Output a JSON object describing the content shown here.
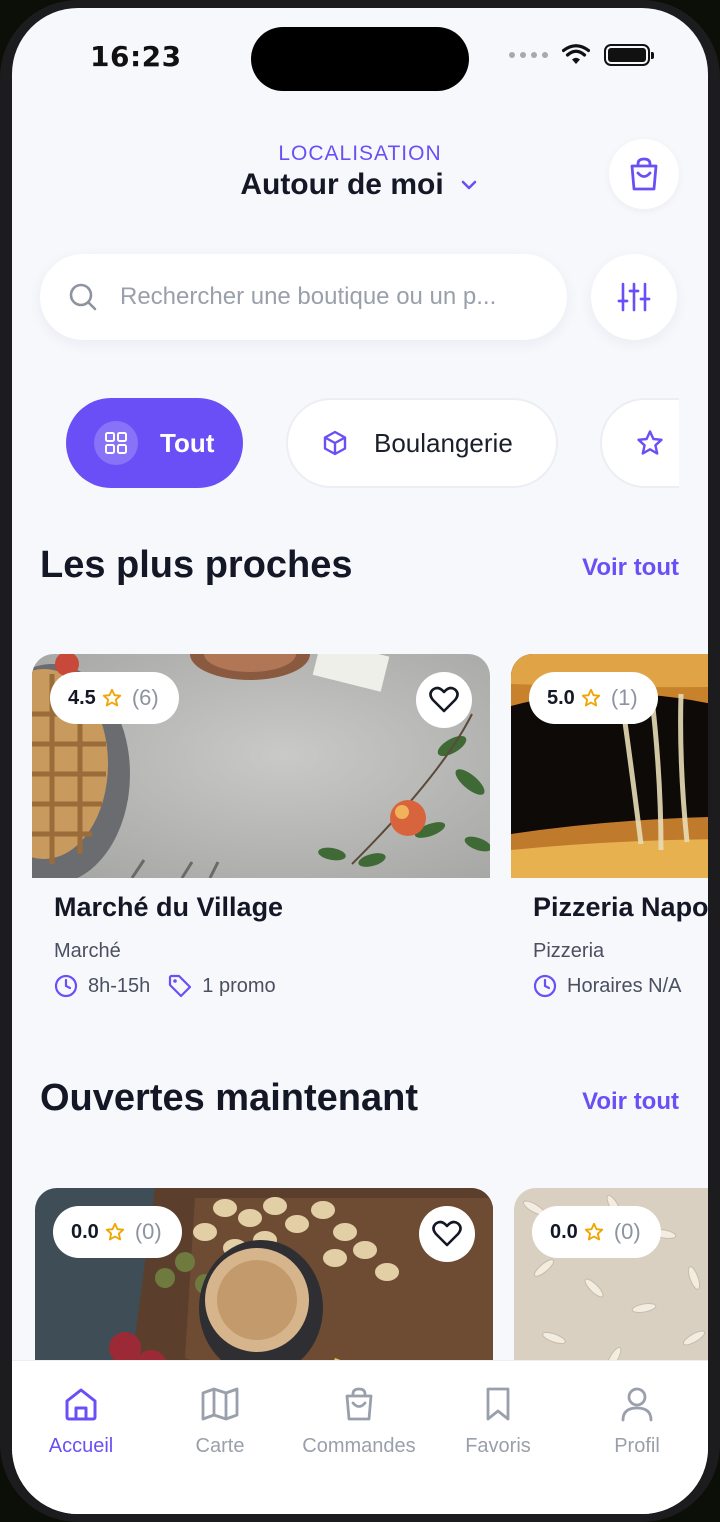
{
  "status": {
    "time": "16:23"
  },
  "location": {
    "label": "LOCALISATION",
    "value": "Autour de moi"
  },
  "search": {
    "placeholder": "Rechercher une boutique ou un p..."
  },
  "categories": [
    {
      "label": "Tout",
      "icon": "grid-icon",
      "active": true
    },
    {
      "label": "Boulangerie",
      "icon": "box-icon",
      "active": false
    },
    {
      "label": "",
      "icon": "star-icon",
      "active": false
    }
  ],
  "sections": [
    {
      "title": "Les plus proches",
      "see_all": "Voir tout",
      "cards": [
        {
          "rating": "4.5",
          "count": "(6)",
          "name": "Marché du Village",
          "category": "Marché",
          "hours": "8h-15h",
          "promo": "1 promo"
        },
        {
          "rating": "5.0",
          "count": "(1)",
          "name": "Pizzeria Napo",
          "category": "Pizzeria",
          "hours": "Horaires N/A"
        }
      ]
    },
    {
      "title": "Ouvertes maintenant",
      "see_all": "Voir tout",
      "cards": [
        {
          "rating": "0.0",
          "count": "(0)"
        },
        {
          "rating": "0.0",
          "count": "(0)"
        }
      ]
    }
  ],
  "tabbar": [
    {
      "label": "Accueil",
      "icon": "home-icon",
      "active": true
    },
    {
      "label": "Carte",
      "icon": "map-icon",
      "active": false
    },
    {
      "label": "Commandes",
      "icon": "bag-icon",
      "active": false
    },
    {
      "label": "Favoris",
      "icon": "bookmark-icon",
      "active": false
    },
    {
      "label": "Profil",
      "icon": "user-icon",
      "active": false
    }
  ],
  "colors": {
    "accent": "#6b4ff6",
    "background": "#f7f8fc",
    "text": "#141826",
    "muted": "#9aa0ab",
    "star": "#f0a500"
  }
}
